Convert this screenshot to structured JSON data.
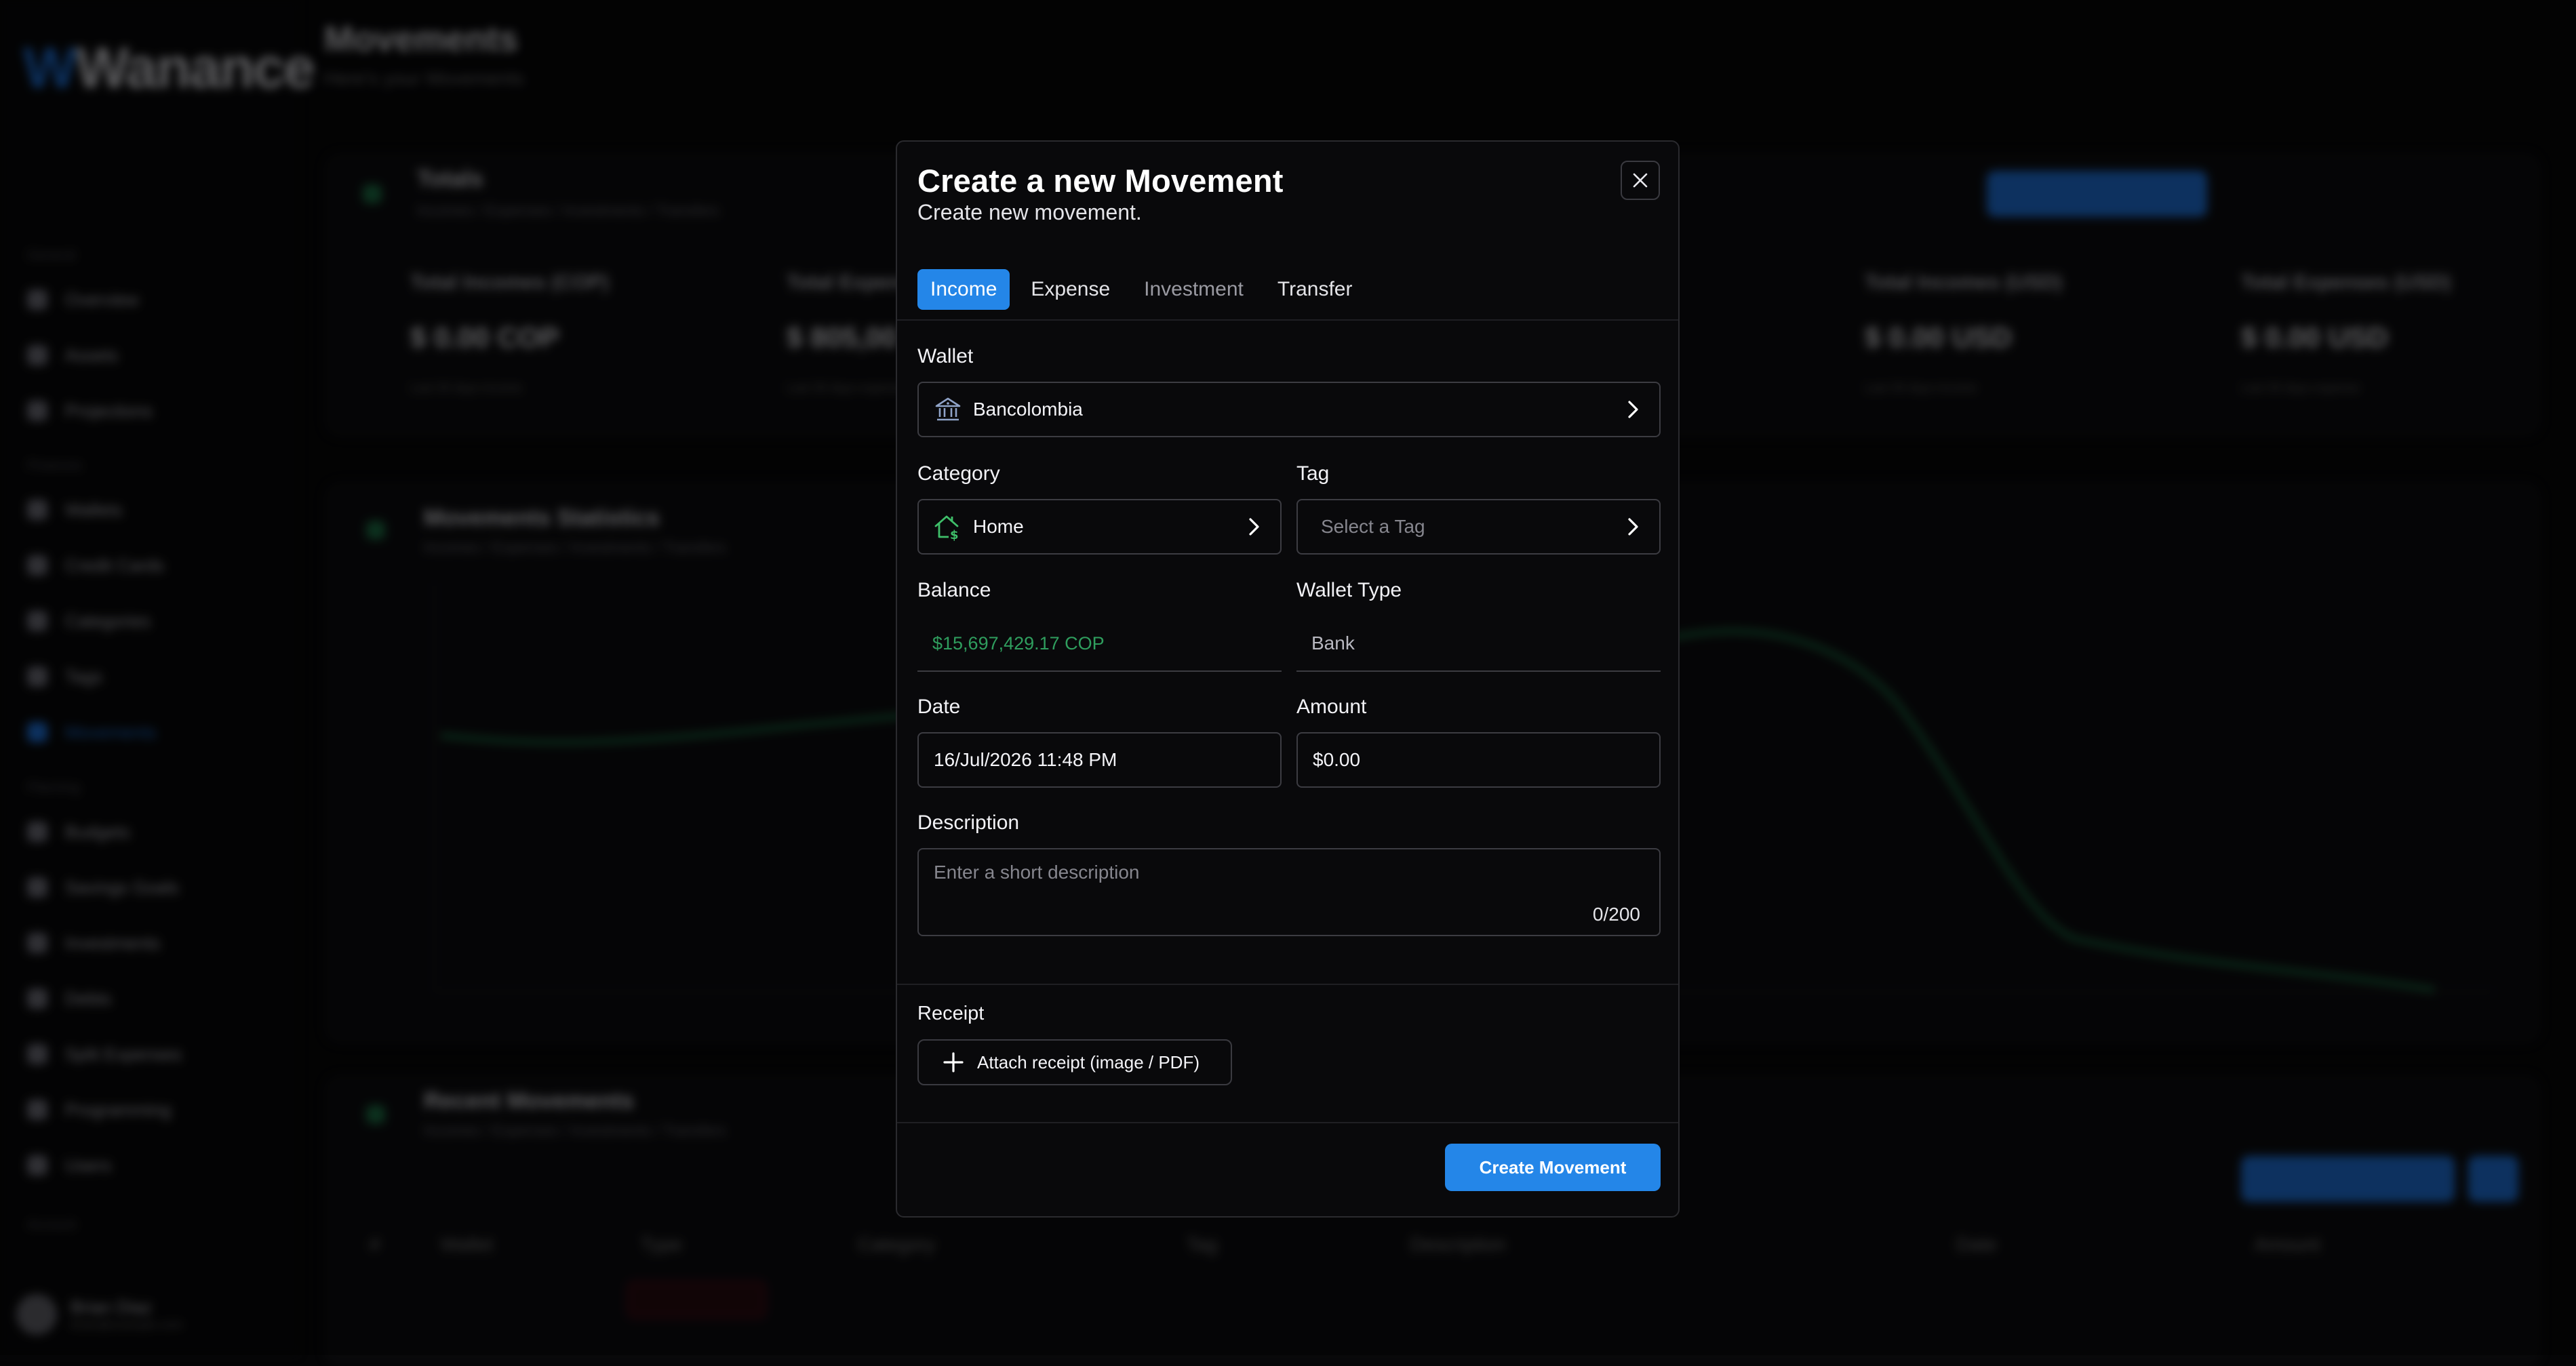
{
  "background": {
    "logo_text": "Wanance",
    "page_title": "Movements",
    "page_subtitle": "Here's your Movements",
    "sidebar_items": [
      "Overview",
      "Assets",
      "Projections",
      "Wallets",
      "Credit Cards",
      "Categories",
      "Tags",
      "Movements",
      "Budgets",
      "Savings Goals",
      "Investments",
      "Debts",
      "Split Expenses",
      "Programming",
      "Users"
    ],
    "sidebar_sections": [
      "General",
      "Finances",
      "Planning",
      "Account"
    ],
    "user_name": "Brian Diaz",
    "user_email": "brian@example.com",
    "totals_title": "Totals",
    "totals_subtitle": "Incomes / Expenses / Investments / Transfers",
    "stats": [
      {
        "label": "Total Incomes (COP)",
        "value": "$ 0.00 COP",
        "sub": "Last 30 days income"
      },
      {
        "label": "Total Expenses (COP)",
        "value": "$ 805,00 COP",
        "sub": "Last 30 days expense"
      },
      {
        "label": "Total Incomes (USD)",
        "value": "$ 0.00 USD",
        "sub": "Last 30 days income"
      },
      {
        "label": "Total Expenses (USD)",
        "value": "$ 0.00 USD",
        "sub": "Last 30 days expense"
      }
    ],
    "stats_title": "Movements Statistics",
    "stats_subtitle": "Incomes / Expenses / Investments / Transfers",
    "recent_title": "Recent Movements",
    "recent_subtitle": "Incomes / Expenses / Investments / Transfers",
    "table_headers": [
      "#",
      "Wallet",
      "Type",
      "Category",
      "Tag",
      "Description",
      "Date",
      "Amount"
    ]
  },
  "modal": {
    "title": "Create a new Movement",
    "subtitle": "Create new movement.",
    "tabs": [
      {
        "label": "Income",
        "active": true
      },
      {
        "label": "Expense",
        "active": false
      },
      {
        "label": "Investment",
        "active": false
      },
      {
        "label": "Transfer",
        "active": false
      }
    ],
    "wallet": {
      "label": "Wallet",
      "value": "Bancolombia",
      "icon": "bank-icon"
    },
    "category": {
      "label": "Category",
      "value": "Home",
      "icon": "house-money-icon"
    },
    "tag": {
      "label": "Tag",
      "placeholder": "Select a Tag"
    },
    "balance": {
      "label": "Balance",
      "value": "$15,697,429.17 COP"
    },
    "wallet_type": {
      "label": "Wallet Type",
      "value": "Bank"
    },
    "date": {
      "label": "Date",
      "value": "16/Jul/2026 11:48 PM"
    },
    "amount": {
      "label": "Amount",
      "value": "$0.00"
    },
    "description": {
      "label": "Description",
      "placeholder": "Enter a short description",
      "counter": "0/200"
    },
    "receipt": {
      "label": "Receipt",
      "attach_label": "Attach receipt (image / PDF)"
    },
    "submit_label": "Create Movement",
    "colors": {
      "accent": "#2486e8",
      "balance_green": "#2f9e5e",
      "category_icon_green": "#3fbf6a",
      "wallet_icon": "#8fa3c8"
    }
  }
}
